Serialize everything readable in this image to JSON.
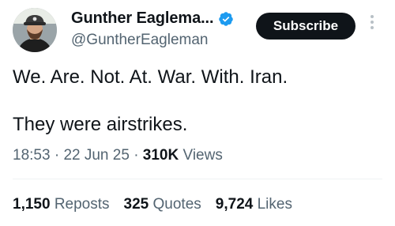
{
  "author": {
    "display_name": "Gunther Eaglema...",
    "handle": "@GuntherEagleman",
    "avatar": "avatar-photo",
    "verified_icon": "verified-badge-icon",
    "verified_color": "#1d9bf0"
  },
  "actions": {
    "subscribe_label": "Subscribe",
    "more_icon": "more-vertical-icon"
  },
  "tweet": {
    "line1": "We. Are. Not. At. War. With. Iran.",
    "line2": "They were airstrikes."
  },
  "meta": {
    "time": "18:53",
    "separator": "·",
    "date": "22 Jun 25",
    "views_count": "310K",
    "views_label": "Views"
  },
  "stats": {
    "reposts_count": "1,150",
    "reposts_label": "Reposts",
    "quotes_count": "325",
    "quotes_label": "Quotes",
    "likes_count": "9,724",
    "likes_label": "Likes"
  },
  "colors": {
    "text": "#0f1419",
    "secondary": "#536471",
    "button_bg": "#0f1419",
    "button_text": "#ffffff"
  }
}
